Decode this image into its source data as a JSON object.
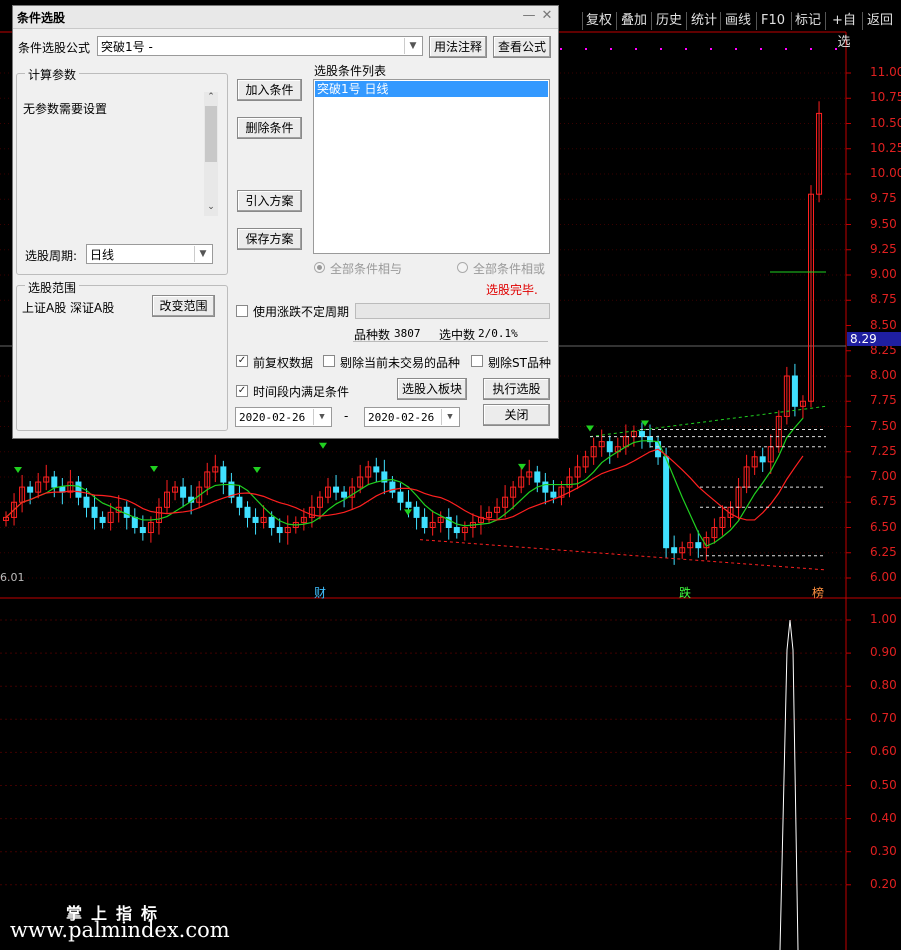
{
  "toolbar": {
    "items": [
      "复权",
      "叠加",
      "历史",
      "统计",
      "画线",
      "F10",
      "标记",
      "+自选",
      "返回"
    ]
  },
  "chart": {
    "current_price_tag": "8.29",
    "left_value": "6.01",
    "markers": {
      "cai": "财",
      "die": "跌",
      "bang": "榜"
    },
    "colors": {
      "up": "#ff2020",
      "down": "#40e0ff",
      "axis": "#c00000",
      "ma_green": "#20d020",
      "ma_red": "#ff2020"
    }
  },
  "chart_data": [
    {
      "type": "candlestick",
      "ylim": [
        5.9,
        11.2
      ],
      "y_ticks": [
        "11.00",
        "10.75",
        "10.50",
        "10.25",
        "10.00",
        "9.75",
        "9.50",
        "9.25",
        "9.00",
        "8.75",
        "8.50",
        "8.25",
        "8.00",
        "7.75",
        "7.50",
        "7.25",
        "7.00",
        "6.75",
        "6.50",
        "6.25",
        "6.00"
      ],
      "series": [
        {
          "values": [
            6.6,
            6.75,
            6.9,
            6.85,
            6.95,
            7.0,
            6.9,
            6.85,
            6.95,
            6.8,
            6.7,
            6.6,
            6.55,
            6.65,
            6.7,
            6.6,
            6.5,
            6.45,
            6.55,
            6.7,
            6.85,
            6.9,
            6.8,
            6.75,
            6.9,
            7.05,
            7.1,
            6.95,
            6.8,
            6.7,
            6.6,
            6.55,
            6.6,
            6.5,
            6.45,
            6.5,
            6.55,
            6.6,
            6.7,
            6.8,
            6.9,
            6.85,
            6.8,
            6.9,
            7.0,
            7.1,
            7.05,
            6.95,
            6.85,
            6.75,
            6.7,
            6.6,
            6.5,
            6.55,
            6.6,
            6.5,
            6.45,
            6.5,
            6.55,
            6.6,
            6.65,
            6.7,
            6.8,
            6.9,
            7.0,
            7.05,
            6.95,
            6.85,
            6.8,
            6.9,
            7.0,
            7.1,
            7.2,
            7.3,
            7.35,
            7.25,
            7.3,
            7.4,
            7.45,
            7.4,
            7.35,
            7.2,
            6.3,
            6.25,
            6.3,
            6.35,
            6.3,
            6.4,
            6.5,
            6.6,
            6.7,
            6.9,
            7.1,
            7.2,
            7.15,
            7.3,
            7.6,
            8.0,
            7.7,
            7.75,
            9.8,
            10.6
          ]
        }
      ]
    },
    {
      "type": "bar",
      "ylim": [
        0.1,
        1.05
      ],
      "y_ticks": [
        "1.00",
        "0.90",
        "0.80",
        "0.70",
        "0.60",
        "0.50",
        "0.40",
        "0.30",
        "0.20"
      ],
      "series": [
        {
          "values": [
            1.0
          ]
        }
      ]
    }
  ],
  "dialog": {
    "title": "条件选股",
    "formula_label": "条件选股公式",
    "formula_value": "突破1号        -",
    "usage_btn": "用法注释",
    "view_btn": "查看公式",
    "params_group": "计算参数",
    "params_text": "无参数需要设置",
    "period_label": "选股周期:",
    "period_value": "日线",
    "add_btn": "加入条件",
    "delete_btn": "删除条件",
    "import_btn": "引入方案",
    "save_btn": "保存方案",
    "cond_list_label": "选股条件列表",
    "cond_item": "突破1号   日线",
    "radio_and": "全部条件相与",
    "radio_or": "全部条件相或",
    "status": "选股完毕.",
    "range_group": "选股范围",
    "range_text": "上证A股 深证A股",
    "change_range_btn": "改变范围",
    "variable_period": "使用涨跌不定周期",
    "count_label": "品种数",
    "count_value": "3807",
    "selected_label": "选中数",
    "selected_value": "2/0.1%",
    "pre_rights": "前复权数据",
    "remove_suspended": "剔除当前未交易的品种",
    "remove_st": "剔除ST品种",
    "time_range": "时间段内满足条件",
    "to_block_btn": "选股入板块",
    "run_btn": "执行选股",
    "date_from": "2020-02-26",
    "date_to": "2020-02-26",
    "date_sep": "-",
    "close_btn": "关闭",
    "check_mark": "✓"
  },
  "watermark": {
    "line1": "掌上指标",
    "line2": "www.palmindex.com"
  }
}
